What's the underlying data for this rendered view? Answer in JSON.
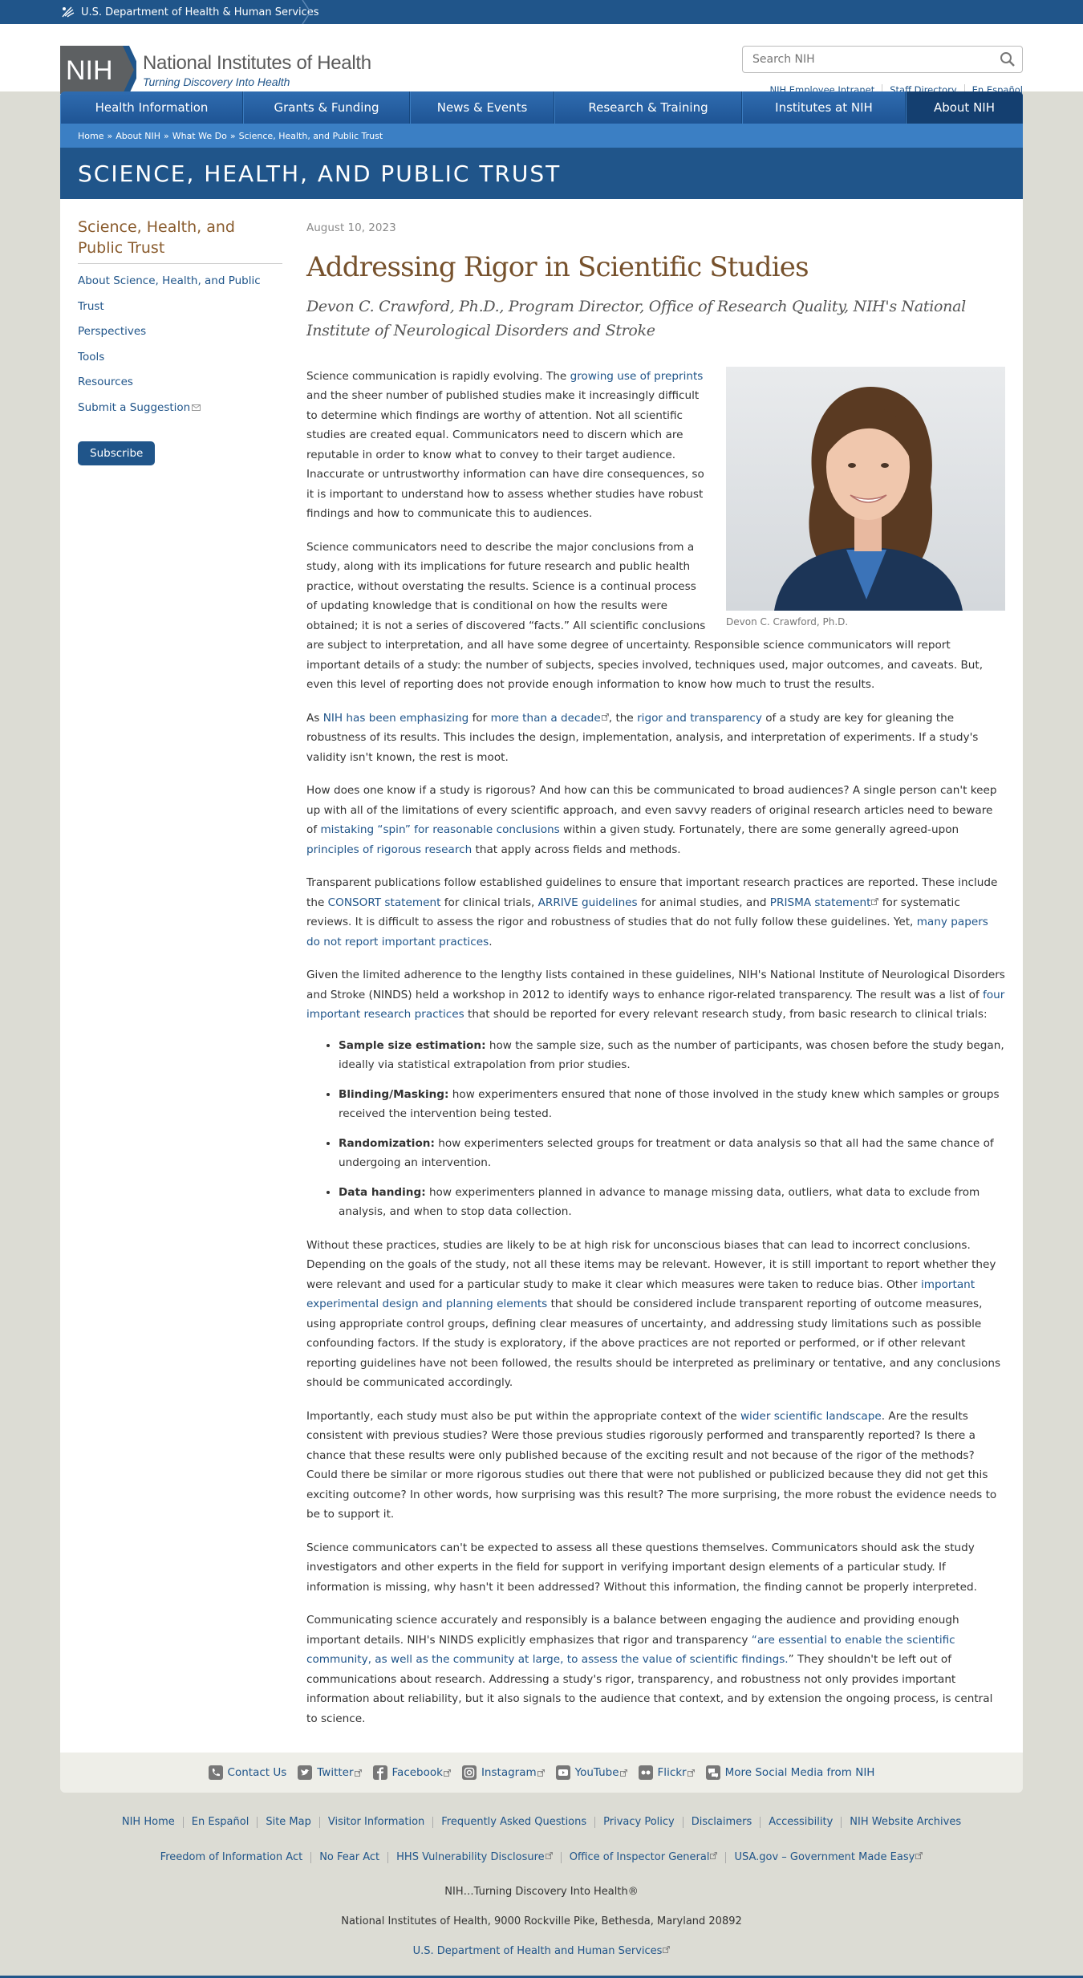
{
  "hhs": {
    "label": "U.S. Department of Health & Human Services"
  },
  "header": {
    "logo_badge": "NIH",
    "logo_name": "National Institutes of Health",
    "logo_tagline": "Turning Discovery Into Health",
    "search_placeholder": "Search NIH",
    "util_links": [
      "NIH Employee Intranet",
      "Staff Directory",
      "En Español"
    ]
  },
  "nav": {
    "items": [
      {
        "label": "Health Information",
        "width": 228
      },
      {
        "label": "Grants & Funding",
        "width": 208
      },
      {
        "label": "News & Events",
        "width": 180
      },
      {
        "label": "Research & Training",
        "width": 234
      },
      {
        "label": "Institutes at NIH",
        "width": 204
      },
      {
        "label": "About NIH",
        "width": 146
      }
    ],
    "active": "About NIH"
  },
  "breadcrumb": [
    "Home",
    "About NIH",
    "What We Do",
    "Science, Health, and Public Trust"
  ],
  "banner": {
    "title": "SCIENCE, HEALTH, AND PUBLIC TRUST"
  },
  "sidebar": {
    "title": "Science, Health, and Public Trust",
    "items": [
      "About Science, Health, and Public Trust",
      "Perspectives",
      "Tools",
      "Resources",
      "Submit a Suggestion"
    ],
    "subscribe": "Subscribe"
  },
  "article": {
    "date": "August 10, 2023",
    "title": "Addressing Rigor in Scientific Studies",
    "byline": "Devon C. Crawford, Ph.D., Program Director, Office of Research Quality, NIH's National Institute of Neurological Disorders and Stroke",
    "photo_caption": "Devon C. Crawford, Ph.D.",
    "p1": {
      "a": "Science communication is rapidly evolving. The ",
      "link": "growing use of preprints",
      "b": " and the sheer number of published studies make it increasingly difficult to determine which findings are worthy of attention. Not all scientific studies are created equal. Communicators need to discern which are reputable in order to know what to convey to their target audience. Inaccurate or untrustworthy information can have dire consequences, so it is important to understand how to assess whether studies have robust findings and how to communicate this to audiences."
    },
    "p2": "Science communicators need to describe the major conclusions from a study, along with its implications for future research and public health practice, without overstating the results. Science is a continual process of updating knowledge that is conditional on how the results were obtained; it is not a series of discovered “facts.” All scientific conclusions are subject to interpretation, and all have some degree of uncertainty. Responsible science communicators will report important details of a study: the number of subjects, species involved, techniques used, major outcomes, and caveats. But, even this level of reporting does not provide enough information to know how much to trust the results.",
    "p3": {
      "a": "As ",
      "link1": "NIH has been emphasizing",
      "b": " for ",
      "link2": "more than a decade",
      "c": ", the ",
      "link3": "rigor and transparency",
      "d": " of a study are key for gleaning the robustness of its results. This includes the design, implementation, analysis, and interpretation of experiments. If a study's validity isn't known, the rest is moot."
    },
    "p4": {
      "a": "How does one know if a study is rigorous? And how can this be communicated to broad audiences? A single person can't keep up with all of the limitations of every scientific approach, and even savvy readers of original research articles need to beware of ",
      "link1": "mistaking “spin” for reasonable conclusions",
      "b": " within a given study. Fortunately, there are some generally agreed-upon ",
      "link2": "principles of rigorous research",
      "c": " that apply across fields and methods."
    },
    "p5": {
      "a": "Transparent publications follow established guidelines to ensure that important research practices are reported. These include the ",
      "link1": "CONSORT statement",
      "b": " for clinical trials, ",
      "link2": "ARRIVE guidelines",
      "c": " for animal studies, and ",
      "link3": "PRISMA statement",
      "d": " for systematic reviews. It is difficult to assess the rigor and robustness of studies that do not fully follow these guidelines. Yet, ",
      "link4": "many papers do not report important practices",
      "e": "."
    },
    "p6": {
      "a": "Given the limited adherence to the lengthy lists contained in these guidelines, NIH's National Institute of Neurological Disorders and Stroke (NINDS) held a workshop in 2012 to identify ways to enhance rigor-related transparency. The result was a list of ",
      "link": "four important research practices",
      "b": " that should be reported for every relevant research study, from basic research to clinical trials:"
    },
    "practices": [
      {
        "term": "Sample size estimation:",
        "desc": " how the sample size, such as the number of participants, was chosen before the study began, ideally via statistical extrapolation from prior studies."
      },
      {
        "term": "Blinding/Masking:",
        "desc": " how experimenters ensured that none of those involved in the study knew which samples or groups received the intervention being tested."
      },
      {
        "term": "Randomization:",
        "desc": " how experimenters selected groups for treatment or data analysis so that all had the same chance of undergoing an intervention."
      },
      {
        "term": "Data handing:",
        "desc": " how experimenters planned in advance to manage missing data, outliers, what data to exclude from analysis, and when to stop data collection."
      }
    ],
    "p7": {
      "a": "Without these practices, studies are likely to be at high risk for unconscious biases that can lead to incorrect conclusions. Depending on the goals of the study, not all these items may be relevant. However, it is still important to report whether they were relevant and used for a particular study to make it clear which measures were taken to reduce bias. Other ",
      "link": "important experimental design and planning elements",
      "b": " that should be considered include transparent reporting of outcome measures, using appropriate control groups, defining clear measures of uncertainty, and addressing study limitations such as possible confounding factors. If the study is exploratory, if the above practices are not reported or performed, or if other relevant reporting guidelines have not been followed, the results should be interpreted as preliminary or tentative, and any conclusions should be communicated accordingly."
    },
    "p8": {
      "a": "Importantly, each study must also be put within the appropriate context of the ",
      "link": "wider scientific landscape",
      "b": ". Are the results consistent with previous studies? Were those previous studies rigorously performed and transparently reported? Is there a chance that these results were only published because of the exciting result and not because of the rigor of the methods? Could there be similar or more rigorous studies out there that were not published or publicized because they did not get this exciting outcome? In other words, how surprising was this result? The more surprising, the more robust the evidence needs to be to support it."
    },
    "p9": "Science communicators can't be expected to assess all these questions themselves. Communicators should ask the study investigators and other experts in the field for support in verifying important design elements of a particular study. If information is missing, why hasn't it been addressed? Without this information, the finding cannot be properly interpreted.",
    "p10": {
      "a": "Communicating science accurately and responsibly is a balance between engaging the audience and providing enough important details. NIH's NINDS explicitly emphasizes that rigor and transparency ",
      "link": "“are essential to enable the scientific community, as well as the community at large, to assess the value of scientific findings.",
      "b": "” They shouldn't be left out of communications about research. Addressing a study's rigor, transparency, and robustness not only provides important information about reliability, but it also signals to the audience that context, and by extension the ongoing process, is central to science."
    }
  },
  "social": [
    "Contact Us",
    "Twitter",
    "Facebook",
    "Instagram",
    "YouTube",
    "Flickr",
    "More Social Media from NIH"
  ],
  "footer": {
    "row1": [
      "NIH Home",
      "En Español",
      "Site Map",
      "Visitor Information",
      "Frequently Asked Questions",
      "Privacy Policy",
      "Disclaimers",
      "Accessibility",
      "NIH Website Archives"
    ],
    "row2": [
      "Freedom of Information Act",
      "No Fear Act",
      "HHS Vulnerability Disclosure",
      "Office of Inspector General",
      "USA.gov – Government Made Easy"
    ],
    "tagline": "NIH…Turning Discovery Into Health®",
    "address": "National Institutes of Health, 9000 Rockville Pike, Bethesda, Maryland 20892",
    "hhs_link": "U.S. Department of Health and Human Services"
  },
  "colors": {
    "brand_blue": "#20558a",
    "accent_brown": "#76512c",
    "nav_active": "#143f70"
  }
}
